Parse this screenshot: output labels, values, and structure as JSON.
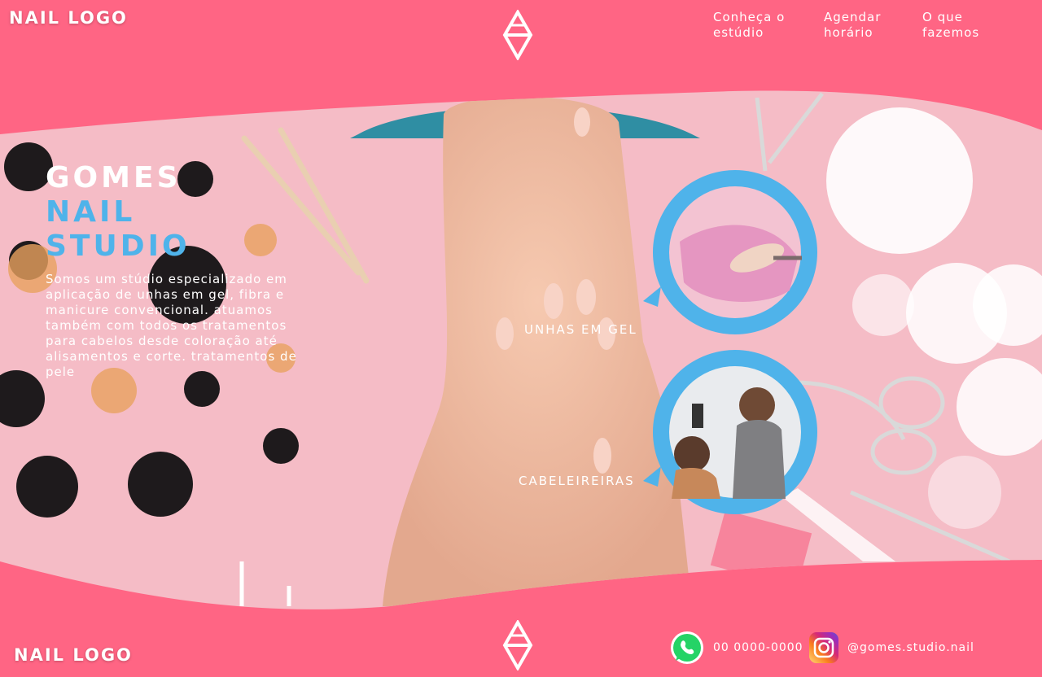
{
  "header": {
    "logo": "NAIL LOGO",
    "nav": [
      {
        "label": "Conheça o estúdio"
      },
      {
        "label": "Agendar horário"
      },
      {
        "label": "O que fazemos"
      }
    ]
  },
  "hero": {
    "title_line1": "GOMES",
    "title_line2": "NAIL",
    "title_line3": "STUDIO",
    "description": "Somos um stúdio especializado em aplicação de unhas em gel, fibra e manicure convencional. atuamos também com todos os tratamentos para cabelos desde coloração até alisamentos e corte. tratamentos de pele"
  },
  "services": [
    {
      "label": "UNHAS EM GEL"
    },
    {
      "label": "CABELEIREIRAS"
    }
  ],
  "footer": {
    "logo": "NAIL LOGO",
    "phone": "00 0000-0000",
    "instagram": "@gomes.studio.nail"
  },
  "colors": {
    "brand_pink": "#ff6584",
    "accent_blue": "#4fb3ea",
    "photo_pink": "#f5bcc6"
  },
  "icons": [
    "diamond-emblem-icon",
    "whatsapp-icon",
    "instagram-icon"
  ]
}
